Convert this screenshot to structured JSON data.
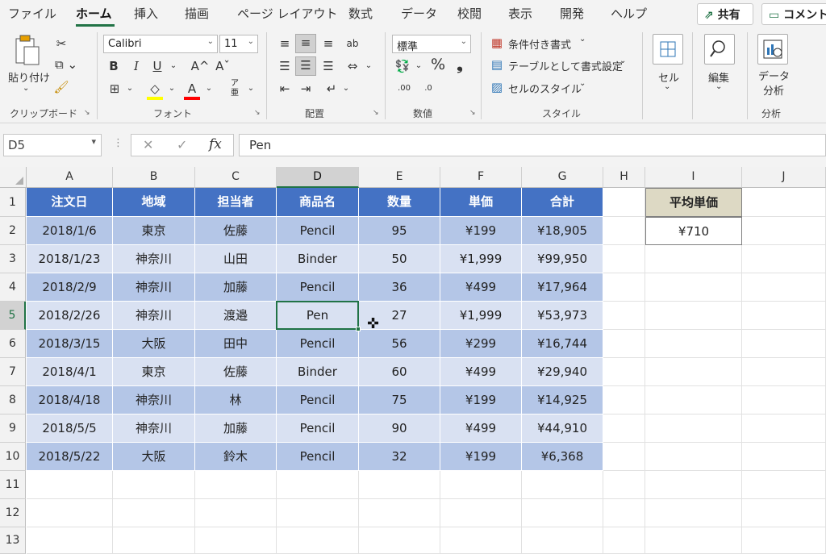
{
  "menu": {
    "tabs": [
      "ファイル",
      "ホーム",
      "挿入",
      "描画",
      "ページ レイアウト",
      "数式",
      "データ",
      "校閲",
      "表示",
      "開発",
      "ヘルプ"
    ],
    "active": "ホーム",
    "share_label": "共有",
    "comment_label": "コメント"
  },
  "ribbon": {
    "clipboard": {
      "paste_label": "貼り付け",
      "group_label": "クリップボード"
    },
    "font": {
      "font_name": "Calibri",
      "font_size": "11",
      "group_label": "フォント",
      "bold": "B",
      "italic": "I",
      "underline": "U",
      "grow": "A^",
      "shrink": "Aˇ",
      "phonetic_top": "ア",
      "phonetic_bottom": "亜"
    },
    "alignment": {
      "group_label": "配置",
      "wrap_glyph": "ab"
    },
    "number": {
      "format": "標準",
      "group_label": "数値",
      "percent": "%",
      "comma": "❟",
      "inc": ".00",
      "dec": ".0"
    },
    "styles": {
      "conditional": "条件付き書式",
      "table": "テーブルとして書式設定",
      "cell_styles": "セルのスタイル",
      "group_label": "スタイル"
    },
    "cells": {
      "label": "セル"
    },
    "editing": {
      "label": "編集"
    },
    "analysis": {
      "label_line1": "データ",
      "label_line2": "分析",
      "group_label": "分析"
    }
  },
  "formula_bar": {
    "name_box": "D5",
    "fx": "fx",
    "formula": "Pen",
    "cancel": "✕",
    "enter": "✓"
  },
  "sheet": {
    "columns": [
      "A",
      "B",
      "C",
      "D",
      "E",
      "F",
      "G",
      "H",
      "I",
      "J"
    ],
    "selected_column": "D",
    "selected_row": 5,
    "rows": [
      "1",
      "2",
      "3",
      "4",
      "5",
      "6",
      "7",
      "8",
      "9",
      "10",
      "11",
      "12",
      "13"
    ],
    "table_header": [
      "注文日",
      "地域",
      "担当者",
      "商品名",
      "数量",
      "単価",
      "合計"
    ],
    "table_rows": [
      [
        "2018/1/6",
        "東京",
        "佐藤",
        "Pencil",
        "95",
        "¥199",
        "¥18,905"
      ],
      [
        "2018/1/23",
        "神奈川",
        "山田",
        "Binder",
        "50",
        "¥1,999",
        "¥99,950"
      ],
      [
        "2018/2/9",
        "神奈川",
        "加藤",
        "Pencil",
        "36",
        "¥499",
        "¥17,964"
      ],
      [
        "2018/2/26",
        "神奈川",
        "渡邉",
        "Pen",
        "27",
        "¥1,999",
        "¥53,973"
      ],
      [
        "2018/3/15",
        "大阪",
        "田中",
        "Pencil",
        "56",
        "¥299",
        "¥16,744"
      ],
      [
        "2018/4/1",
        "東京",
        "佐藤",
        "Binder",
        "60",
        "¥499",
        "¥29,940"
      ],
      [
        "2018/4/18",
        "神奈川",
        "林",
        "Pencil",
        "75",
        "¥199",
        "¥14,925"
      ],
      [
        "2018/5/5",
        "神奈川",
        "加藤",
        "Pencil",
        "90",
        "¥499",
        "¥44,910"
      ],
      [
        "2018/5/22",
        "大阪",
        "鈴木",
        "Pencil",
        "32",
        "¥199",
        "¥6,368"
      ]
    ],
    "avg_label": "平均単価",
    "avg_value": "¥710"
  },
  "colors": {
    "header_blue": "#4472c4",
    "band_dark": "#b4c6e7",
    "band_light": "#d9e1f2",
    "tan": "#ddd9c4",
    "accent_green": "#217346"
  }
}
